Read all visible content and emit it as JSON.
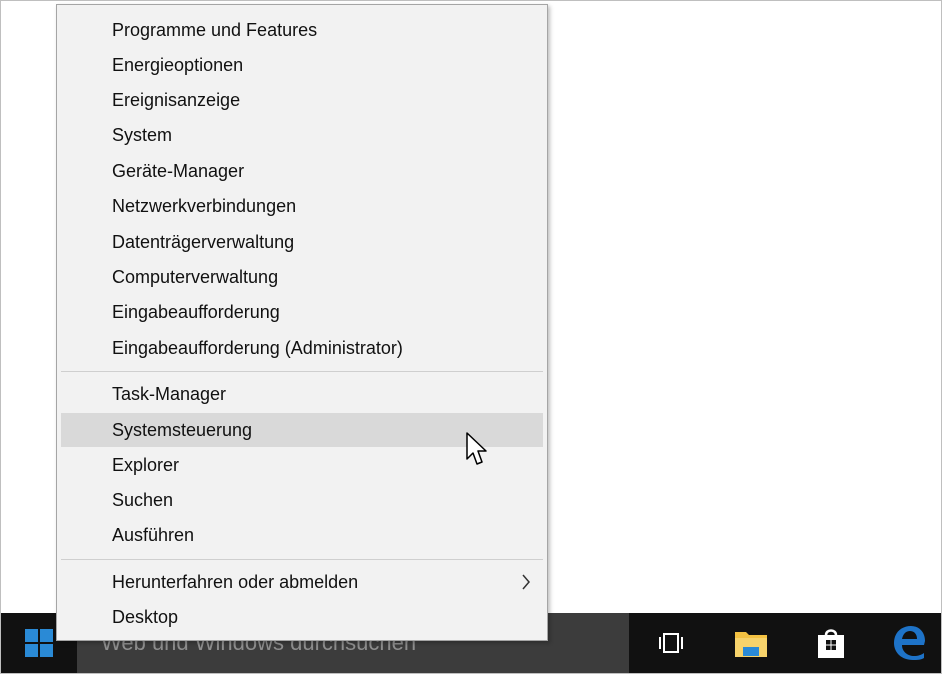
{
  "menu": {
    "group1": [
      {
        "label": "Programme und Features"
      },
      {
        "label": "Energieoptionen"
      },
      {
        "label": "Ereignisanzeige"
      },
      {
        "label": "System"
      },
      {
        "label": "Geräte-Manager"
      },
      {
        "label": "Netzwerkverbindungen"
      },
      {
        "label": "Datenträgerverwaltung"
      },
      {
        "label": "Computerverwaltung"
      },
      {
        "label": "Eingabeaufforderung"
      },
      {
        "label": "Eingabeaufforderung (Administrator)"
      }
    ],
    "group2": [
      {
        "label": "Task-Manager"
      },
      {
        "label": "Systemsteuerung",
        "highlighted": true
      },
      {
        "label": "Explorer"
      },
      {
        "label": "Suchen"
      },
      {
        "label": "Ausführen"
      }
    ],
    "group3": [
      {
        "label": "Herunterfahren oder abmelden",
        "has_submenu": true
      },
      {
        "label": "Desktop"
      }
    ]
  },
  "taskbar": {
    "search_placeholder": "Web und Windows durchsuchen",
    "icons": [
      "windows-start-icon",
      "task-view-icon",
      "file-explorer-icon",
      "store-icon",
      "edge-icon"
    ]
  },
  "colors": {
    "taskbar_bg": "#111111",
    "search_bg": "#3c3c3c",
    "menu_bg": "#f2f2f2",
    "highlight": "#d9d9d9",
    "windows_blue": "#2a8ad6",
    "edge_blue": "#1e73c8",
    "folder_yellow": "#f4c242"
  }
}
